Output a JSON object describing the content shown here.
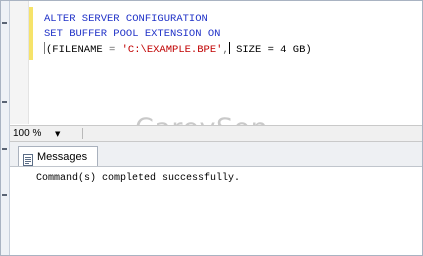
{
  "editor": {
    "lines": [
      {
        "kw1": "ALTER SERVER CONFIGURATION"
      },
      {
        "kw1": "SET BUFFER POOL EXTENSION ON"
      },
      {
        "open": "(FILENAME",
        "eq": " = ",
        "str": "'C:\\EXAMPLE.BPE'",
        "comma": ",",
        "rest": " SIZE = 4 GB)"
      }
    ]
  },
  "watermark": "CareySon",
  "zoom": {
    "value": "100 %"
  },
  "results": {
    "tab_label": "Messages",
    "message": "Command(s) completed successfully."
  },
  "colors": {
    "keyword": "#1f31c7",
    "string": "#c00000",
    "changebar": "#f6e36a"
  },
  "icons": {
    "zoom_dropdown": "chevron-down-icon",
    "messages_tab": "messages-icon"
  }
}
